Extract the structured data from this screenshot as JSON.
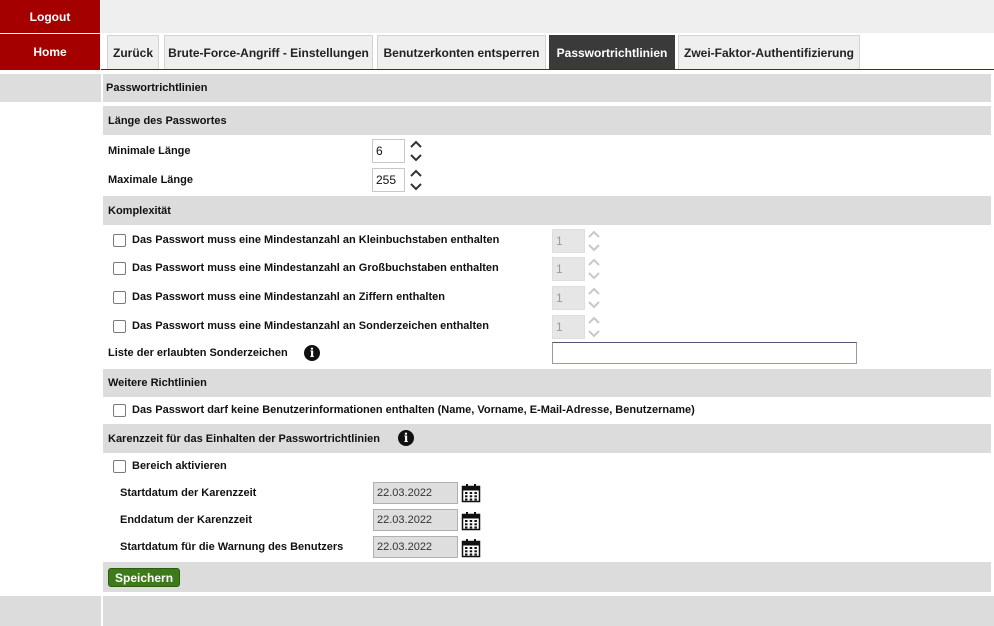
{
  "nav": {
    "logout_label": "Logout",
    "home_label": "Home"
  },
  "tabs": [
    {
      "label": "Zurück",
      "active": false
    },
    {
      "label": "Brute-Force-Angriff - Einstellungen",
      "active": false
    },
    {
      "label": "Benutzerkonten entsperren",
      "active": false
    },
    {
      "label": "Passwortrichtlinien",
      "active": true
    },
    {
      "label": "Zwei-Faktor-Authentifizierung",
      "active": false
    }
  ],
  "page_title": "Passwortrichtlinien",
  "length": {
    "section_title": "Länge des Passwortes",
    "min_label": "Minimale Länge",
    "min_value": "6",
    "max_label": "Maximale Länge",
    "max_value": "255"
  },
  "complexity": {
    "section_title": "Komplexität",
    "rules": [
      {
        "label": "Das Passwort muss eine Mindestanzahl an Kleinbuchstaben enthalten",
        "checked": false,
        "value": "1"
      },
      {
        "label": "Das Passwort muss eine Mindestanzahl an Großbuchstaben enthalten",
        "checked": false,
        "value": "1"
      },
      {
        "label": "Das Passwort muss eine Mindestanzahl an Ziffern enthalten",
        "checked": false,
        "value": "1"
      },
      {
        "label": "Das Passwort muss eine Mindestanzahl an Sonderzeichen enthalten",
        "checked": false,
        "value": "1"
      }
    ],
    "special_chars_label": "Liste der erlaubten Sonderzeichen",
    "special_chars_value": ""
  },
  "further": {
    "section_title": "Weitere Richtlinien",
    "no_user_info_label": "Das Passwort darf keine Benutzerinformationen enthalten (Name, Vorname, E-Mail-Adresse, Benutzername)",
    "no_user_info_checked": false
  },
  "grace": {
    "section_title": "Karenzzeit für das Einhalten der Passwortrichtlinien",
    "activate_label": "Bereich aktivieren",
    "activate_checked": false,
    "start_label": "Startdatum der Karenzzeit",
    "start_value": "22.03.2022",
    "end_label": "Enddatum der Karenzzeit",
    "end_value": "22.03.2022",
    "warn_label": "Startdatum für die Warnung des Benutzers",
    "warn_value": "22.03.2022"
  },
  "save_label": "Speichern",
  "colors": {
    "brand_red": "#a50000",
    "active_tab": "#3a3a3a",
    "save_green": "#3d7a1a",
    "section_grey": "#dcdcdc"
  }
}
